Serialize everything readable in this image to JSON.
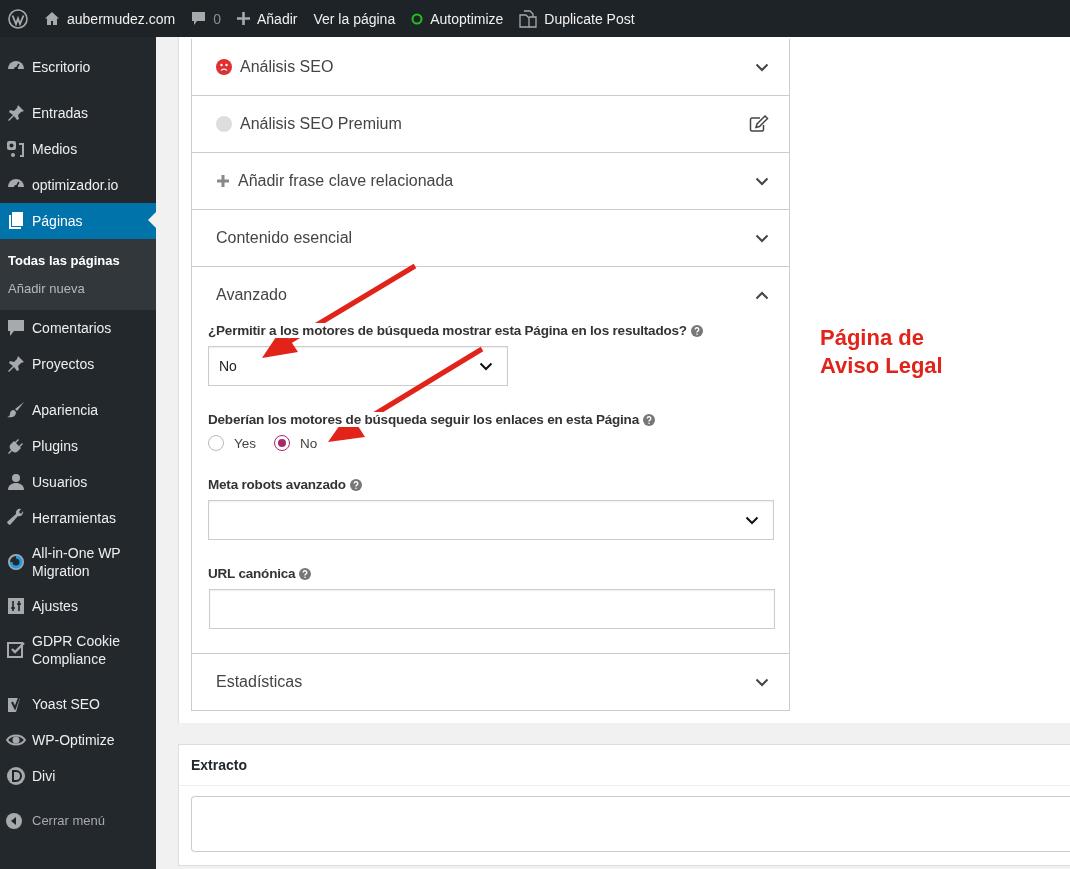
{
  "admin_bar": {
    "site": "aubermudez.com",
    "comments": "0",
    "new": "Añadir",
    "view": "Ver la página",
    "autoptimize": "Autoptimize",
    "duplicate": "Duplicate Post"
  },
  "sidebar": {
    "groups": [
      [
        {
          "label": "Escritorio",
          "selected": false
        }
      ],
      [
        {
          "label": "Entradas",
          "selected": false
        },
        {
          "label": "Medios",
          "selected": false
        },
        {
          "label": "optimizador.io",
          "selected": false
        },
        {
          "label": "Páginas",
          "selected": true,
          "submenu": [
            {
              "label": "Todas las páginas",
              "selected": true
            },
            {
              "label": "Añadir nueva",
              "selected": false
            }
          ]
        },
        {
          "label": "Comentarios",
          "selected": false
        },
        {
          "label": "Proyectos",
          "selected": false
        }
      ],
      [
        {
          "label": "Apariencia",
          "selected": false
        },
        {
          "label": "Plugins",
          "selected": false
        },
        {
          "label": "Usuarios",
          "selected": false
        },
        {
          "label": "Herramientas",
          "selected": false
        },
        {
          "label": "All-in-One WP Migration",
          "selected": false
        },
        {
          "label": "Ajustes",
          "selected": false
        },
        {
          "label": "GDPR Cookie Compliance",
          "selected": false
        }
      ],
      [
        {
          "label": "Yoast SEO",
          "selected": false
        },
        {
          "label": "WP-Optimize",
          "selected": false
        },
        {
          "label": "Divi",
          "selected": false
        }
      ]
    ],
    "collapse": "Cerrar menú"
  },
  "seo_box": {
    "sections": [
      {
        "label": "Análisis SEO",
        "kind": "score",
        "color": "#dc3232",
        "editable": false,
        "expanded": false
      },
      {
        "label": "Análisis SEO Premium",
        "kind": "score",
        "color": "#dddddd",
        "editable": true
      },
      {
        "label": "Añadir frase clave relacionada",
        "kind": "add",
        "editable": false,
        "expanded": false
      },
      {
        "label": "Contenido esencial",
        "kind": "plain",
        "editable": false,
        "expanded": false
      },
      {
        "label": "Avanzado",
        "kind": "plain",
        "editable": false,
        "expanded": true,
        "fields": [
          {
            "kind": "select",
            "label": "¿Permitir a los motores de búsqueda mostrar esta Página en los resultados?",
            "value": "No"
          },
          {
            "kind": "radio",
            "label": "Deberían los motores de búsqueda seguir los enlaces en esta Página",
            "options": [
              {
                "label": "Yes",
                "selected": false
              },
              {
                "label": "No",
                "selected": true
              }
            ]
          },
          {
            "kind": "select",
            "label": "Meta robots avanzado",
            "wide": true
          },
          {
            "kind": "text",
            "label": "URL canónica"
          }
        ]
      },
      {
        "label": "Estadísticas",
        "kind": "plain",
        "editable": false,
        "expanded": false
      }
    ]
  },
  "excerpt": {
    "title": "Extracto"
  },
  "annotation": {
    "text": "Página de Aviso Legal"
  }
}
